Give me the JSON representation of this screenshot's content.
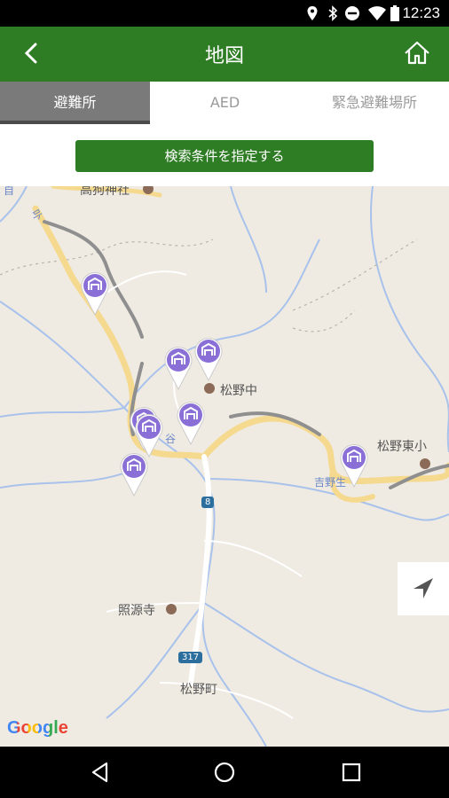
{
  "status_bar": {
    "time": "12:23",
    "icons": [
      "location-icon",
      "bluetooth-icon",
      "do-not-disturb-icon",
      "wifi-icon",
      "battery-icon"
    ]
  },
  "app_bar": {
    "title": "地図",
    "back_icon": "chevron-left-icon",
    "home_icon": "home-icon"
  },
  "tabs": [
    {
      "label": "避難所",
      "active": true
    },
    {
      "label": "AED",
      "active": false
    },
    {
      "label": "緊急避難場所",
      "active": false
    }
  ],
  "search_button": {
    "label": "検索条件を指定する"
  },
  "map": {
    "labels": {
      "shrine": "高狗神社",
      "school_mid": "松野中",
      "school_east": "松野東小",
      "temple": "照源寺",
      "station": "吉野生",
      "town": "松野町",
      "small_top": "自",
      "small_road": "卟",
      "small_center": "谷"
    },
    "route_shields": {
      "r8": "8",
      "r317": "317"
    },
    "pin_icon": "shelter-pin-icon",
    "pin_color": "#8a6fd6",
    "my_location_icon": "navigation-arrow-icon",
    "attribution": "Google"
  },
  "nav_bar": {
    "back": "triangle-back-icon",
    "home": "circle-home-icon",
    "recents": "square-recents-icon"
  }
}
